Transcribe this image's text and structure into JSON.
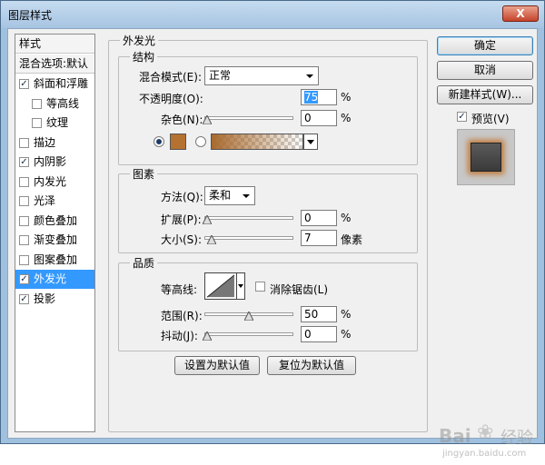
{
  "window": {
    "title": "图层样式",
    "close_label": "X"
  },
  "style_list": {
    "header": "样式",
    "blend_options": "混合选项:默认",
    "items": [
      {
        "label": "斜面和浮雕",
        "checked": true
      },
      {
        "label": "等高线",
        "checked": false
      },
      {
        "label": "纹理",
        "checked": false
      },
      {
        "label": "描边",
        "checked": false
      },
      {
        "label": "内阴影",
        "checked": true
      },
      {
        "label": "内发光",
        "checked": false
      },
      {
        "label": "光泽",
        "checked": false
      },
      {
        "label": "颜色叠加",
        "checked": false
      },
      {
        "label": "渐变叠加",
        "checked": false
      },
      {
        "label": "图案叠加",
        "checked": false
      },
      {
        "label": "外发光",
        "checked": true,
        "selected": true
      },
      {
        "label": "投影",
        "checked": true
      }
    ]
  },
  "outer_glow": {
    "title": "外发光",
    "structure": {
      "title": "结构",
      "blend_mode_label": "混合模式(E):",
      "blend_mode_value": "正常",
      "opacity_label": "不透明度(O):",
      "opacity_value": "75",
      "opacity_unit": "%",
      "opacity_level": 0.75,
      "noise_label": "杂色(N):",
      "noise_value": "0",
      "noise_unit": "%",
      "noise_level": 0,
      "color_hex": "#b5712f"
    },
    "elements": {
      "title": "图素",
      "technique_label": "方法(Q):",
      "technique_value": "柔和",
      "spread_label": "扩展(P):",
      "spread_value": "0",
      "spread_unit": "%",
      "spread_level": 0,
      "size_label": "大小(S):",
      "size_value": "7",
      "size_unit": "像素",
      "size_level": 0.05
    },
    "quality": {
      "title": "品质",
      "contour_label": "等高线:",
      "antialias_label": "消除锯齿(L)",
      "antialias_checked": false,
      "range_label": "范围(R):",
      "range_value": "50",
      "range_unit": "%",
      "range_level": 0.5,
      "jitter_label": "抖动(J):",
      "jitter_value": "0",
      "jitter_unit": "%",
      "jitter_level": 0
    },
    "make_default": "设置为默认值",
    "reset_default": "复位为默认值"
  },
  "buttons": {
    "ok": "确定",
    "cancel": "取消",
    "new_style": "新建样式(W)...",
    "preview_label": "预览(V)",
    "preview_checked": true
  },
  "watermark": {
    "brand": "Bai",
    "suffix": "经验",
    "url": "jingyan.baidu.com"
  }
}
